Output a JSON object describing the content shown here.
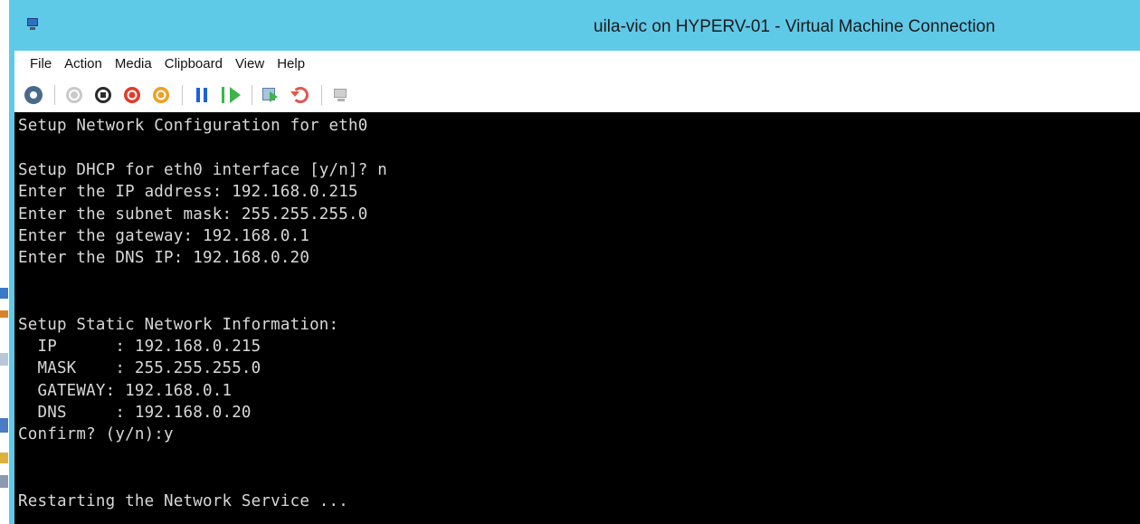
{
  "window": {
    "title": "uila-vic on HYPERV-01 - Virtual Machine Connection",
    "icon": "vm-connection-icon"
  },
  "menubar": {
    "items": [
      "File",
      "Action",
      "Media",
      "Clipboard",
      "View",
      "Help"
    ]
  },
  "toolbar": {
    "buttons": [
      {
        "name": "ctrl-alt-del-icon"
      },
      {
        "name": "start-icon"
      },
      {
        "name": "turn-off-icon"
      },
      {
        "name": "shut-down-icon"
      },
      {
        "name": "save-icon"
      },
      {
        "name": "pause-icon"
      },
      {
        "name": "resume-icon"
      },
      {
        "name": "checkpoint-icon"
      },
      {
        "name": "revert-icon"
      },
      {
        "name": "enhanced-session-icon"
      }
    ]
  },
  "console": {
    "lines": [
      "Setup Network Configuration for eth0",
      "",
      "Setup DHCP for eth0 interface [y/n]? n",
      "Enter the IP address: 192.168.0.215",
      "Enter the subnet mask: 255.255.255.0",
      "Enter the gateway: 192.168.0.1",
      "Enter the DNS IP: 192.168.0.20",
      "",
      "",
      "Setup Static Network Information:",
      "  IP      : 192.168.0.215",
      "  MASK    : 255.255.255.0",
      "  GATEWAY: 192.168.0.1",
      "  DNS     : 192.168.0.20",
      "Confirm? (y/n):y",
      "",
      "",
      "Restarting the Network Service ..."
    ]
  },
  "colors": {
    "titlebar": "#5fc9e8",
    "console_bg": "#000000",
    "console_fg": "#d8d8d8"
  }
}
